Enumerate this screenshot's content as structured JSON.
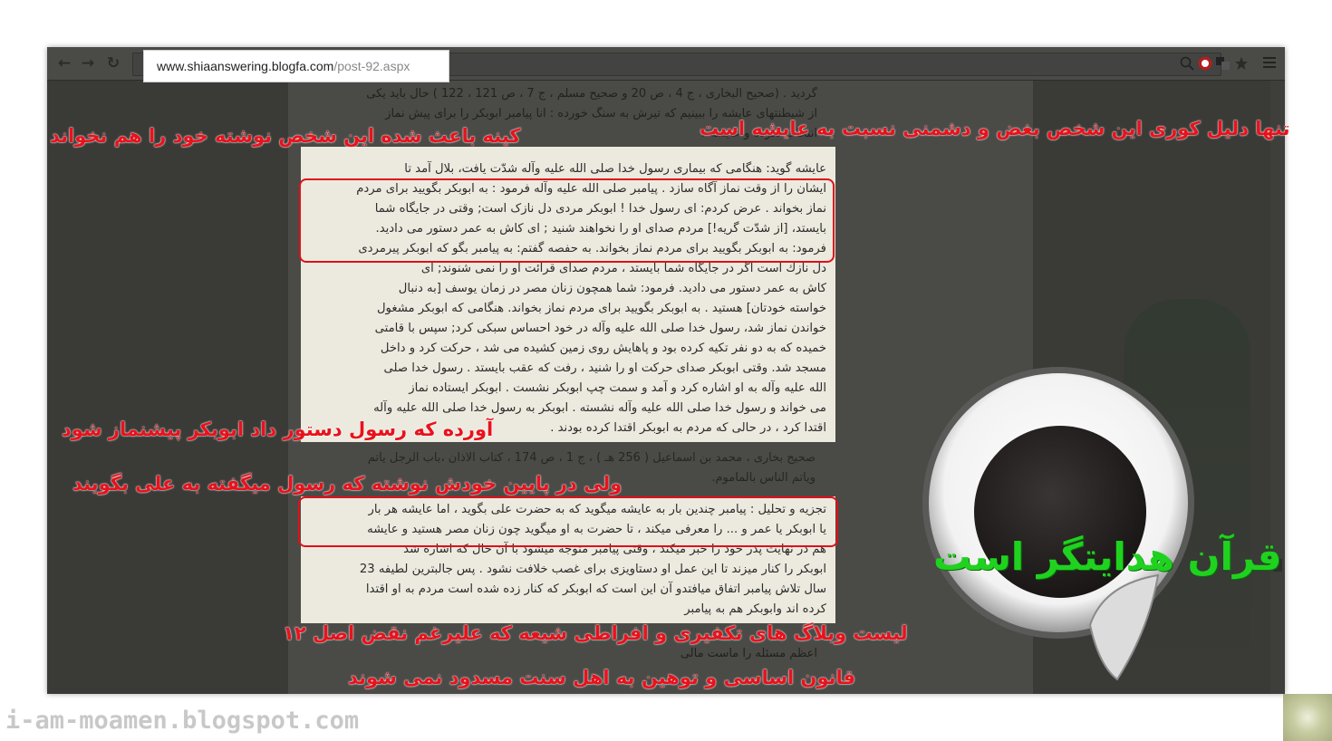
{
  "browser": {
    "url_domain": "www.shiaanswering.blogfa.com",
    "url_path": "/post-92.aspx",
    "icons": [
      "back-arrow-icon",
      "forward-arrow-icon",
      "reload-icon",
      "page-icon",
      "zoom-icon",
      "extension-icon",
      "translate-icon",
      "star-icon",
      "menu-icon"
    ]
  },
  "article": {
    "lines": [
      "عایشه گوید: هنگامی که بیماری رسول خدا صلی الله علیه وآله شدّت یافت، بلال آمد تا",
      "ایشان را از وقت نماز آگاه سازد . پیامبر صلی الله علیه وآله فرمود : به ابوبکر بگویید برای مردم",
      "نماز بخواند . عرض کردم: ای رسول خدا ! ابوبکر مردی دل نازک است; وقتی در جایگاه شما",
      "بایستد، [از شدّت گریه!] مردم صدای او را نخواهند شنید ; ای کاش به عمر دستور می دادید.",
      "فرمود: به ابوبکر بگویید برای مردم نماز بخواند. به حفصه گفتم: به پیامبر بگو که ابوبکر پیرمردی",
      "دل نازك است اگر در جایگاه شما بایستد ، مردم صدای قرائت او را نمی شنوند; ای",
      "کاش به عمر دستور می دادید. فرمود: شما همچون زنان مصر در زمان یوسف [به دنبال",
      "خواسته خودتان] هستید . به ابوبکر بگویید برای مردم نماز بخواند. هنگامی که ابوبکر مشغول",
      "خواندن نماز شد، رسول خدا صلی الله علیه وآله در خود احساس سبکی کرد; سپس با قامتی",
      "خمیده که به دو نفر تکیه کرده بود و پاهایش روی زمین کشیده می شد ، حرکت کرد و داخل",
      "مسجد شد. وقتی ابوبکر صدای حرکت او را شنید ، رفت که عقب بایستد . رسول خدا صلی",
      "الله علیه وآله به او اشاره کرد و آمد و سمت چپ ابوبکر نشست . ابوبکر ایستاده نماز",
      "می خواند و رسول خدا صلی الله علیه وآله نشسته . ابوبکر به رسول خدا صلی الله علیه وآله",
      "اقتدا کرد ، در حالی که مردم به ابوبکر اقتدا کرده بودند ."
    ],
    "lines_b": [
      "صحیح بخاری ، محمد بن اسماعیل ( 256 هـ ) ، ج 1 ، ص 174 ، کتاب الاذان ،باب الرجل یأتم",
      "ویأتم الناس بالمأموم.",
      "",
      "تجزیه و تحلیل : پیامبر چندین بار به عایشه میگوید که به حضرت علی بگوید ، اما عایشه هر بار",
      "یا ابوبکر یا عمر و ... را معرفی میکند ، تا حضرت به او میگوید چون زنان مصر هستید و عایشه",
      "هم در نهایت پدر خود را خبر میکند ، وقتی پیامبر متوجه میشود با آن حال که اشاره شد",
      "ابوبکر را کنار میزند تا این عمل او دستاویزی برای غصب خلافت نشود . پس جالبترین لطیفه 23",
      "سال تلاش پیامبر اتفاق میافتدو آن این است که ابوبکر که کنار زده شده است مردم به او اقتدا",
      "کرده اند وابوبکر هم به پیامبر"
    ],
    "top_lines": [
      "گردید . (صحیح البخاری ، ج 4 ، ص 20 و صحیح مسلم ، ج 7 ، ص 121 ، 122 ) حال باید یکی",
      "از شیطنتهای عایشه را ببینیم که تیرش به سنگ خورده : انا پیامبر ابوبکر را برای پیش نماز",
      "انتخاب نکرده و عایشه ؟"
    ],
    "bottom_lines": [
      "اعظم مسئله را ماست مالی"
    ]
  },
  "captions": {
    "c1": "تنها دلیل کوری این شخص بغض و دشمنی نسبت به عایشه است",
    "c2": "کینه باعث شده این شخص نوشته خود را هم نخواند",
    "c3": "آورده که رسول دستور داد ابوبکر پیشنماز شود",
    "c4": "ولی در پایین خودش نوشته که رسول میگفته به علی بگویند",
    "c5": "لیست وبلاگ های تکفیری و افراطی شیعه که علیرغم نقض اصل ۱۲",
    "c6": "قانون اساسی و توهین به اهل سنت مسدود نمی شوند"
  },
  "logo": {
    "text": "قرآن هدایتگر است"
  },
  "watermark": "i-am-moamen.blogspot.com",
  "colors": {
    "caption": "#e8121c",
    "logo_text": "#1fd21f",
    "article_bg": "#eceadf"
  }
}
